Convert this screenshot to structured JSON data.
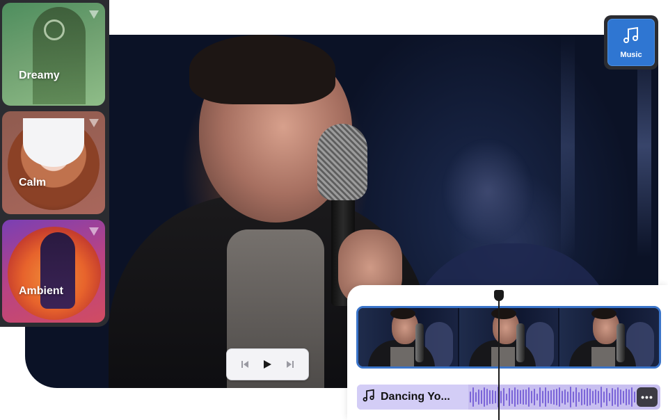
{
  "moods": [
    {
      "label": "Dreamy"
    },
    {
      "label": "Calm"
    },
    {
      "label": "Ambient"
    }
  ],
  "music_button": {
    "label": "Music",
    "icon": "music-note-icon"
  },
  "player": {
    "controls": [
      "skip-back-icon",
      "play-icon",
      "skip-forward-icon"
    ]
  },
  "timeline": {
    "audio_track": {
      "title": "Dancing Yo...",
      "more_label": "•••"
    }
  },
  "colors": {
    "accent_blue": "#2f76d2",
    "clip_border": "#3a74c9",
    "audio_track_bg": "#c8bff0",
    "waveform": "#7a64d8",
    "panel_dark": "#2b2c31"
  }
}
